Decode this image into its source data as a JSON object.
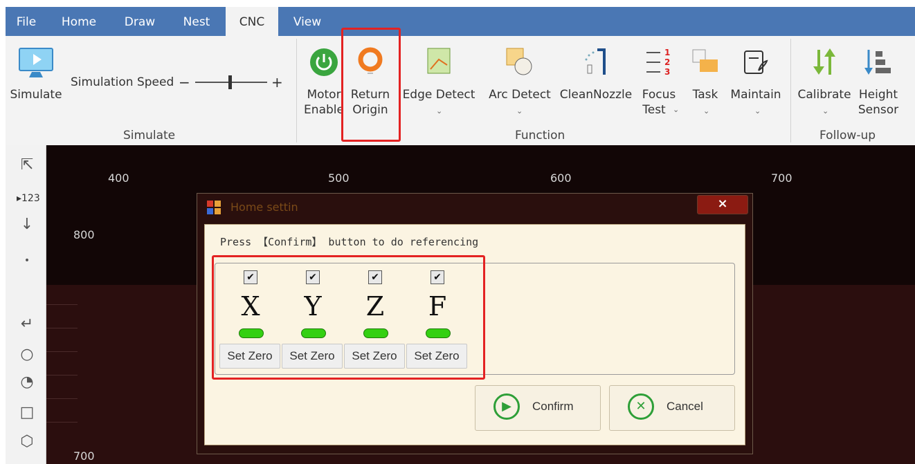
{
  "menubar": {
    "tabs": [
      {
        "label": "File"
      },
      {
        "label": "Home"
      },
      {
        "label": "Draw"
      },
      {
        "label": "Nest"
      },
      {
        "label": "CNC",
        "active": true
      },
      {
        "label": "View"
      }
    ]
  },
  "ribbon": {
    "simulate": {
      "button_label": "Simulate",
      "speed_label": "Simulation Speed",
      "minus": "−",
      "plus": "+",
      "group_label": "Simulate"
    },
    "function": {
      "motor_enable": [
        "Motor",
        "Enable"
      ],
      "return_origin": [
        "Return",
        "Origin"
      ],
      "edge_detect": "Edge Detect",
      "arc_detect": "Arc Detect",
      "clean_nozzle": "CleanNozzle",
      "focus_test": [
        "Focus",
        "Test"
      ],
      "task": "Task",
      "maintain": "Maintain",
      "group_label": "Function"
    },
    "followup": {
      "calibrate": "Calibrate",
      "height_sensor": [
        "Height",
        "Sensor"
      ],
      "group_label": "Follow-up"
    }
  },
  "canvas": {
    "ruler_x": [
      "400",
      "500",
      "600",
      "700"
    ],
    "ruler_y": [
      "800",
      "700"
    ]
  },
  "dialog": {
    "title": "Home settin",
    "close": "×",
    "message": "Press 【Confirm】 button to do referencing",
    "axes": [
      {
        "letter": "X",
        "checked": true,
        "set_zero": "Set Zero"
      },
      {
        "letter": "Y",
        "checked": true,
        "set_zero": "Set Zero"
      },
      {
        "letter": "Z",
        "checked": true,
        "set_zero": "Set Zero"
      },
      {
        "letter": "F",
        "checked": true,
        "set_zero": "Set Zero"
      }
    ],
    "confirm_label": "Confirm",
    "cancel_label": "Cancel",
    "check_glyph": "✔"
  },
  "colors": {
    "menubar": "#4a77b4",
    "highlight": "#e32222",
    "led": "#34d012",
    "accent_green": "#2e9f38"
  }
}
